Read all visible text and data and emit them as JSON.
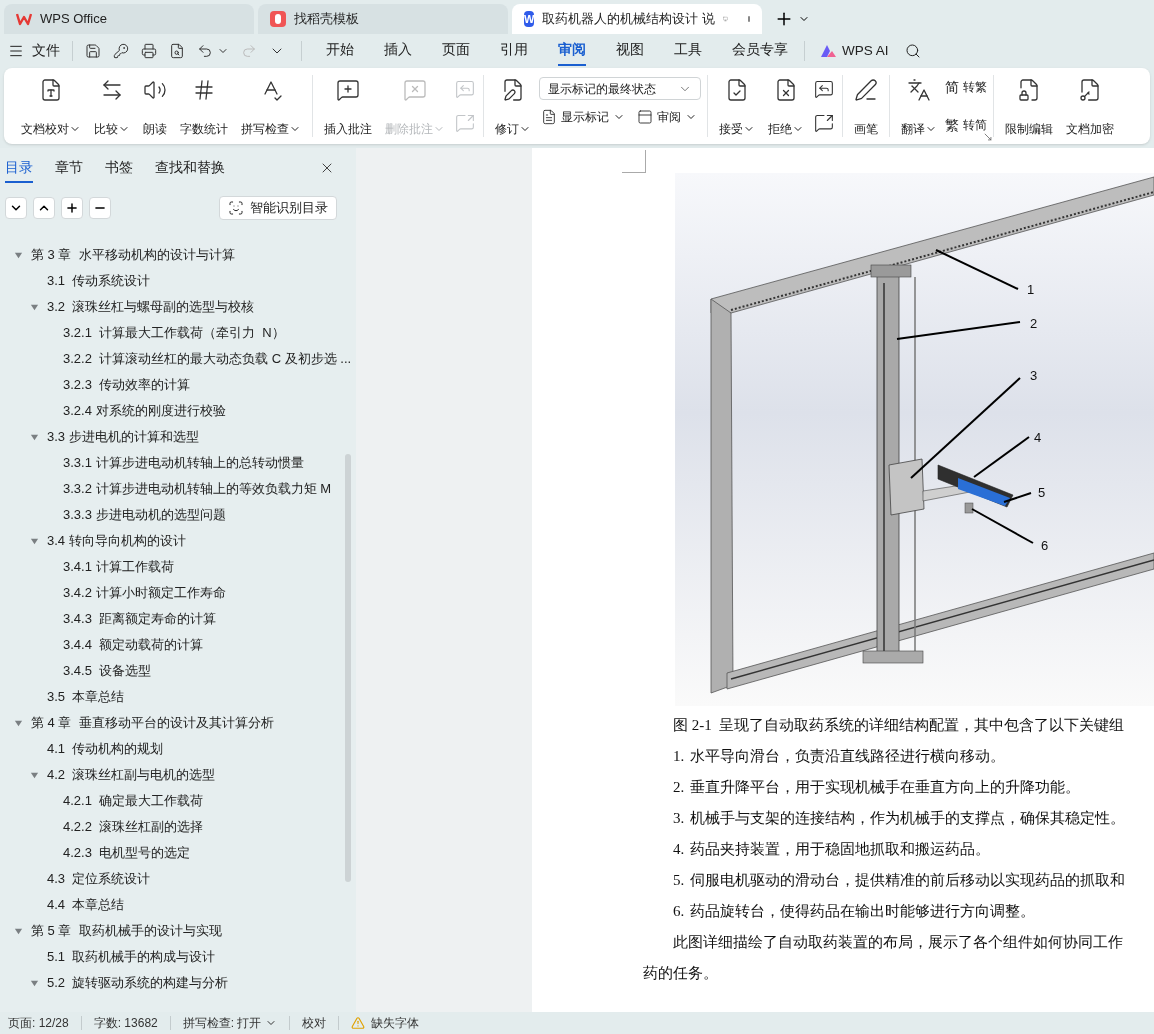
{
  "title_bar": {
    "tabs": [
      {
        "label": "WPS Office",
        "selected": false
      },
      {
        "label": "找稻壳模板",
        "selected": false
      },
      {
        "label": "取药机器人的机械结构设计 说",
        "badge": "W",
        "selected": true
      }
    ]
  },
  "menu": {
    "file": "文件",
    "tabs": [
      {
        "label": "开始",
        "selected": false
      },
      {
        "label": "插入",
        "selected": false
      },
      {
        "label": "页面",
        "selected": false
      },
      {
        "label": "引用",
        "selected": false
      },
      {
        "label": "审阅",
        "selected": true
      },
      {
        "label": "视图",
        "selected": false
      },
      {
        "label": "工具",
        "selected": false
      },
      {
        "label": "会员专享",
        "selected": false
      }
    ],
    "ai": "WPS AI"
  },
  "ribbon": {
    "groups": [
      {
        "blocks": [
          {
            "kind": "large",
            "label": "文档校对",
            "caret": true,
            "disabled": false
          },
          {
            "kind": "large",
            "label": "比较",
            "caret": true,
            "disabled": false
          },
          {
            "kind": "large",
            "label": "朗读",
            "caret": false,
            "disabled": false
          },
          {
            "kind": "large",
            "label": "字数统计",
            "caret": false,
            "disabled": false
          },
          {
            "kind": "large",
            "label": "拼写检查",
            "caret": true,
            "disabled": false
          }
        ]
      },
      {
        "blocks": [
          {
            "kind": "large",
            "label": "插入批注",
            "caret": false,
            "disabled": false
          },
          {
            "kind": "large",
            "label": "删除批注",
            "caret": true,
            "disabled": true
          },
          {
            "kind": "icons",
            "buttons": [
              {
                "disabled": true
              },
              {
                "disabled": true
              }
            ]
          }
        ]
      },
      {
        "blocks": [
          {
            "kind": "large",
            "label": "修订",
            "caret": true,
            "disabled": false
          },
          {
            "kind": "dropdown",
            "value": "显示标记的最终状态",
            "buttons": [
              {
                "label": "显示标记",
                "caret": true
              },
              {
                "label": "审阅",
                "caret": true
              }
            ]
          }
        ]
      },
      {
        "blocks": [
          {
            "kind": "large",
            "label": "接受",
            "caret": true,
            "disabled": false
          },
          {
            "kind": "large",
            "label": "拒绝",
            "caret": true,
            "disabled": false
          },
          {
            "kind": "icons",
            "buttons": [
              {
                "disabled": false
              },
              {
                "disabled": false
              }
            ]
          }
        ]
      },
      {
        "blocks": [
          {
            "kind": "large",
            "label": "画笔",
            "caret": false,
            "disabled": false
          }
        ]
      },
      {
        "launcher": true,
        "blocks": [
          {
            "kind": "large",
            "label": "翻译",
            "caret": true,
            "disabled": false
          },
          {
            "kind": "small",
            "buttons": [
              {
                "glyph": "简",
                "label": "转繁"
              },
              {
                "glyph": "繁",
                "label": "转简"
              }
            ]
          }
        ]
      },
      {
        "blocks": [
          {
            "kind": "large",
            "label": "限制编辑",
            "caret": false,
            "disabled": false
          },
          {
            "kind": "large",
            "label": "文档加密",
            "caret": false,
            "disabled": false
          }
        ]
      }
    ]
  },
  "sidebar": {
    "tabs": [
      {
        "label": "目录",
        "selected": true
      },
      {
        "label": "章节",
        "selected": false
      },
      {
        "label": "书签",
        "selected": false
      },
      {
        "label": "查找和替换",
        "selected": false
      }
    ],
    "smart_button": "智能识别目录",
    "outline": [
      {
        "label": "第 3 章  水平移动机构的设计与计算",
        "expanded": true,
        "children": [
          {
            "label": "3.1  传动系统设计"
          },
          {
            "label": "3.2  滚珠丝杠与螺母副的选型与校核",
            "expanded": true,
            "children": [
              {
                "label": "3.2.1  计算最大工作载荷（牵引力  N）"
              },
              {
                "label": "3.2.2  计算滚动丝杠的最大动态负载 C 及初步选 ..."
              },
              {
                "label": "3.2.3  传动效率的计算"
              },
              {
                "label": "3.2.4 对系统的刚度进行校验"
              }
            ]
          },
          {
            "label": "3.3 步进电机的计算和选型",
            "expanded": true,
            "children": [
              {
                "label": "3.3.1 计算步进电动机转轴上的总转动惯量"
              },
              {
                "label": "3.3.2 计算步进电动机转轴上的等效负载力矩 M"
              },
              {
                "label": "3.3.3 步进电动机的选型问题"
              }
            ]
          },
          {
            "label": "3.4 转向导向机构的设计",
            "expanded": true,
            "children": [
              {
                "label": "3.4.1 计算工作载荷"
              },
              {
                "label": "3.4.2 计算小时额定工作寿命"
              },
              {
                "label": "3.4.3  距离额定寿命的计算"
              },
              {
                "label": "3.4.4  额定动载荷的计算"
              },
              {
                "label": "3.4.5  设备选型"
              }
            ]
          },
          {
            "label": "3.5  本章总结"
          }
        ]
      },
      {
        "label": "第 4 章  垂直移动平台的设计及其计算分析",
        "expanded": true,
        "children": [
          {
            "label": "4.1  传动机构的规划"
          },
          {
            "label": "4.2  滚珠丝杠副与电机的选型",
            "expanded": true,
            "children": [
              {
                "label": "4.2.1  确定最大工作载荷"
              },
              {
                "label": "4.2.2  滚珠丝杠副的选择"
              },
              {
                "label": "4.2.3  电机型号的选定"
              }
            ]
          },
          {
            "label": "4.3  定位系统设计"
          },
          {
            "label": "4.4  本章总结"
          }
        ]
      },
      {
        "label": "第 5 章  取药机械手的设计与实现",
        "expanded": true,
        "children": [
          {
            "label": "5.1  取药机械手的构成与设计"
          },
          {
            "label": "5.2  旋转驱动系统的构建与分析",
            "expanded": true
          }
        ]
      }
    ]
  },
  "document": {
    "figure": {
      "callouts": [
        {
          "label": "1"
        },
        {
          "label": "2"
        },
        {
          "label": "3"
        },
        {
          "label": "4"
        },
        {
          "label": "5"
        },
        {
          "label": "6"
        }
      ]
    },
    "caption": "图 2-1  呈现了自动取药系统的详细结构配置，其中包含了以下关键组",
    "list": [
      {
        "number": "1.",
        "text": "水平导向滑台，负责沿直线路径进行横向移动。"
      },
      {
        "number": "2.",
        "text": "垂直升降平台，用于实现机械手在垂直方向上的升降功能。"
      },
      {
        "number": "3.",
        "text": "机械手与支架的连接结构，作为机械手的支撑点，确保其稳定性。"
      },
      {
        "number": "4.",
        "text": "药品夹持装置，用于稳固地抓取和搬运药品。"
      },
      {
        "number": "5.",
        "text": "伺服电机驱动的滑动台，提供精准的前后移动以实现药品的抓取和"
      },
      {
        "number": "6.",
        "text": "药品旋转台，使得药品在输出时能够进行方向调整。"
      }
    ],
    "paragraph": [
      "此图详细描绘了自动取药装置的布局，展示了各个组件如何协同工作",
      "药的任务。"
    ]
  },
  "status_bar": {
    "page": "页面: 12/28",
    "words": "字数: 13682",
    "spell": "拼写检查: 打开",
    "proof": "校对",
    "font_warning": "缺失字体"
  }
}
